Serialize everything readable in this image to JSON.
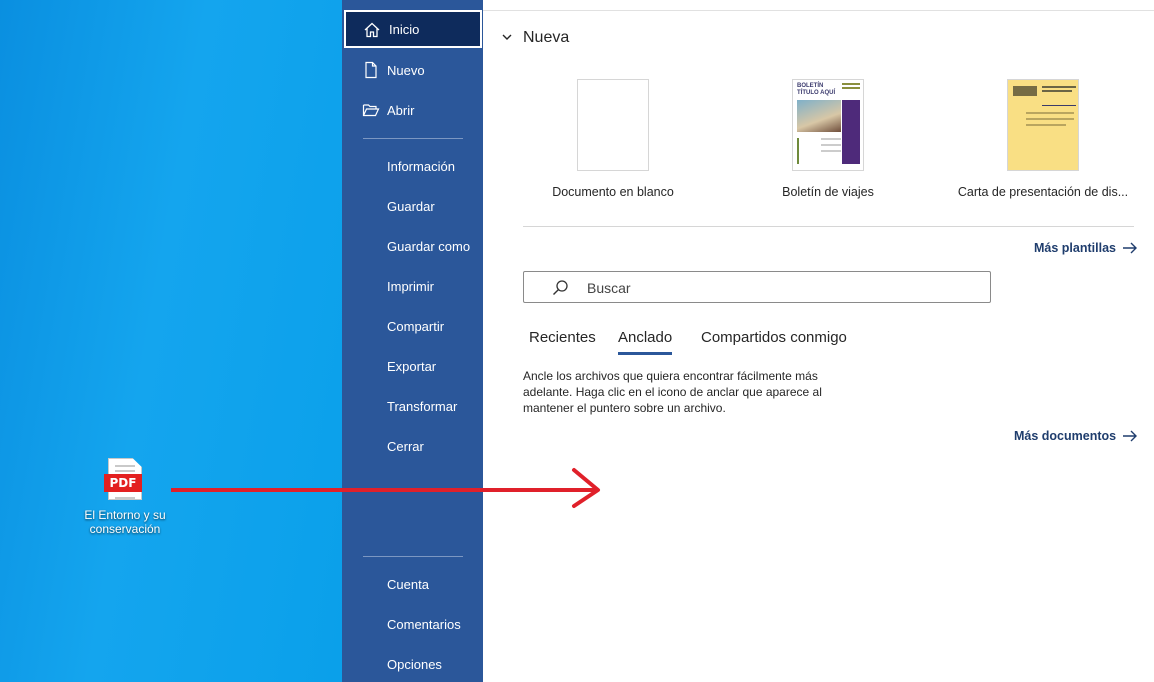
{
  "desktop": {
    "file_icon": {
      "badge": "PDF",
      "label": "El Entorno y su conservación"
    }
  },
  "nav": {
    "items": [
      {
        "label": "Inicio",
        "icon": "home-icon",
        "active": true
      },
      {
        "label": "Nuevo",
        "icon": "new-document-icon"
      },
      {
        "label": "Abrir",
        "icon": "folder-open-icon"
      },
      {
        "label": "Información"
      },
      {
        "label": "Guardar"
      },
      {
        "label": "Guardar como"
      },
      {
        "label": "Imprimir"
      },
      {
        "label": "Compartir"
      },
      {
        "label": "Exportar"
      },
      {
        "label": "Transformar"
      },
      {
        "label": "Cerrar"
      },
      {
        "label": "Cuenta"
      },
      {
        "label": "Comentarios"
      },
      {
        "label": "Opciones"
      }
    ],
    "colors": {
      "background": "#2b579a",
      "active": "#0e2b5c"
    }
  },
  "main": {
    "section_title": "Nueva",
    "templates": [
      {
        "label": "Documento en blanco"
      },
      {
        "label": "Boletín de viajes",
        "thumb_title_1": "BOLETÍN",
        "thumb_title_2": "TÍTULO AQUÍ"
      },
      {
        "label": "Carta de presentación de dis..."
      }
    ],
    "more_templates": "Más plantillas",
    "search_placeholder": "Buscar",
    "tabs": [
      {
        "label": "Recientes"
      },
      {
        "label": "Anclado",
        "active": true
      },
      {
        "label": "Compartidos conmigo"
      }
    ],
    "pinned_hint": "Ancle los archivos que quiera encontrar fácilmente más adelante. Haga clic en el icono de anclar que aparece al mantener el puntero sobre un archivo.",
    "more_documents": "Más documentos"
  },
  "annotation": {
    "arrow_color": "#e0202a"
  }
}
